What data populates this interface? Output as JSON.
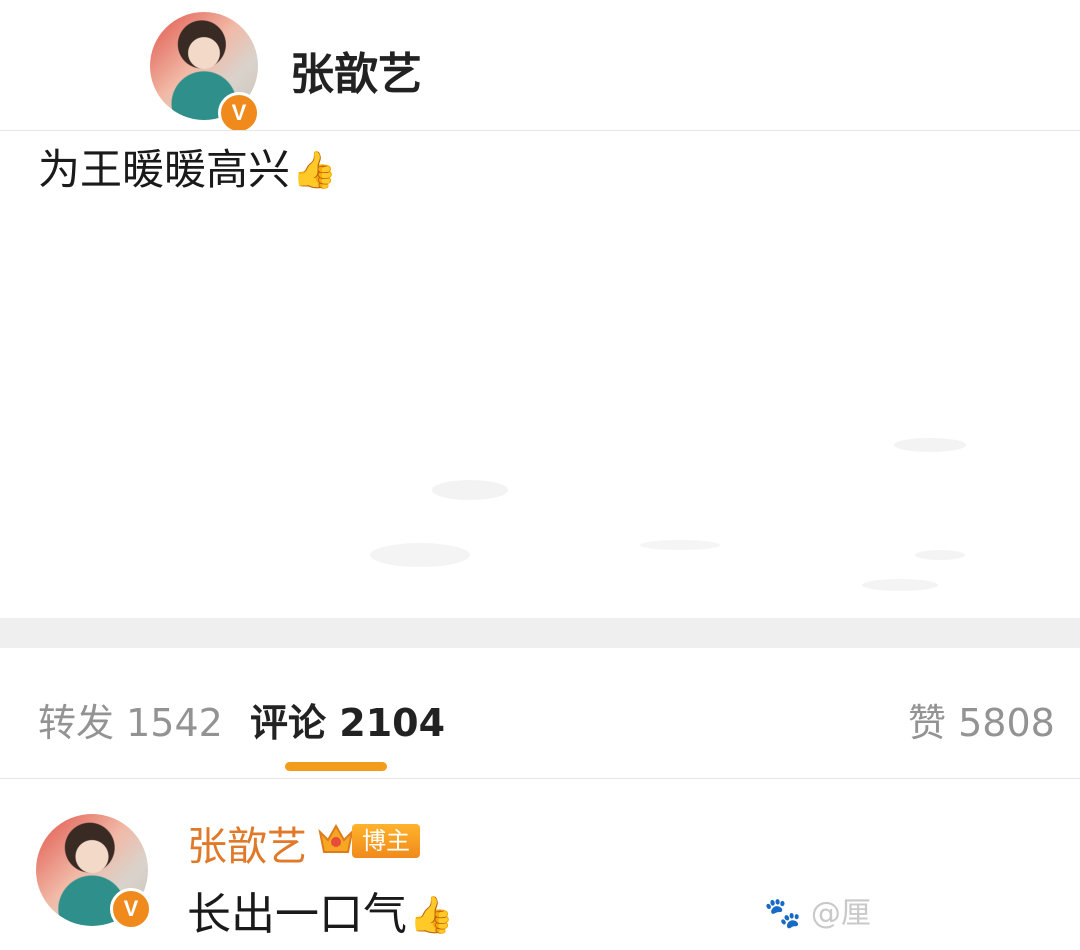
{
  "post": {
    "author": "张歆艺",
    "verified_badge": "V",
    "text": "为王暖暖高兴",
    "emoji": "👍"
  },
  "stats": {
    "repost_label": "转发",
    "repost_count": "1542",
    "comment_label": "评论",
    "comment_count": "2104",
    "like_label": "赞",
    "like_count": "5808",
    "active_tab": "comment"
  },
  "comment": {
    "author": "张歆艺",
    "role_badge": "博主",
    "text": "长出一口气",
    "emoji": "👍"
  },
  "watermark": "@厘"
}
